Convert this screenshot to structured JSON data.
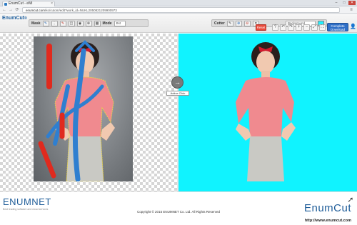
{
  "browser": {
    "tab_title": "EnumCut - eMi",
    "tab_close": "×",
    "window_buttons": [
      "–",
      "□",
      "✕"
    ],
    "url_host": "enumcut.com",
    "url_path": "/ko/cutom/edit?work_id=NUKL2050821209900973",
    "nav": {
      "back": "←",
      "forward": "→",
      "reload": "⟳"
    },
    "menu": "≡"
  },
  "app": {
    "logo": "EnumCut",
    "logo_suffix": "®",
    "mask_toolbox": {
      "label": "Mask",
      "mode_label": "Mode",
      "mode_value": "Bst"
    },
    "cutter_toolbox": {
      "label": "Cutter",
      "background_label": "Background",
      "background_color": "#10f3ff"
    },
    "reset_label": "Reset",
    "complete_label": "Complete",
    "complete_sub": "Download"
  },
  "workspace": {
    "active_click_label": "Active Click",
    "active_click_icon": "→",
    "left_background": "transparent-checker",
    "right_background": "#10f3ff",
    "stroke_colors": {
      "foreground": "#2f7fd0",
      "background": "#e02a1e"
    }
  },
  "footer": {
    "brand_left": "ENUMNET",
    "brand_left_tag": "Best leading software and cloud services",
    "copyright": "Copyright © 2015 ENUMNET Co. Ltd. All Rights Reserved",
    "brand_right": "EnumCut",
    "site": "http://www.enumcut.com"
  }
}
